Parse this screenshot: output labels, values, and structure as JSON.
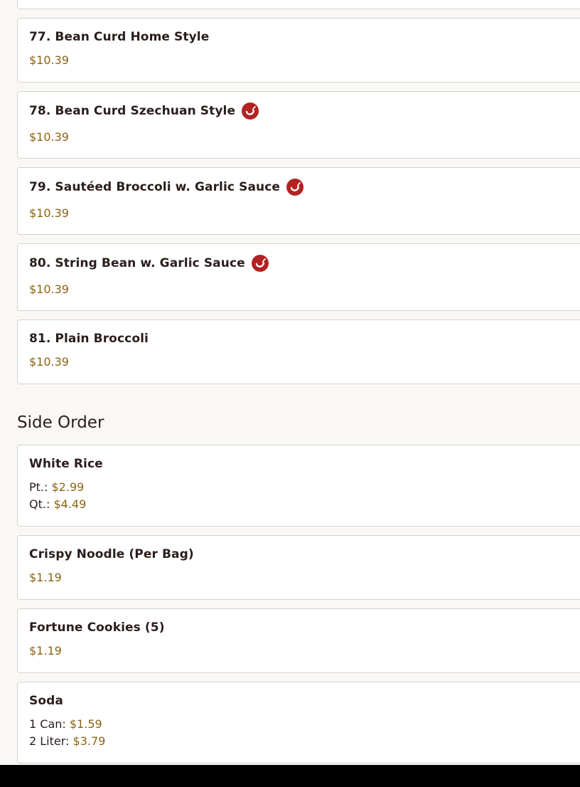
{
  "vegetable_items": [
    {
      "title": "77. Bean Curd Home Style",
      "price": "$10.39",
      "spicy": false
    },
    {
      "title": "78. Bean Curd Szechuan Style",
      "price": "$10.39",
      "spicy": true
    },
    {
      "title": "79. Sautéed Broccoli w. Garlic Sauce",
      "price": "$10.39",
      "spicy": true
    },
    {
      "title": "80. String Bean w. Garlic Sauce",
      "price": "$10.39",
      "spicy": true
    },
    {
      "title": "81. Plain Broccoli",
      "price": "$10.39",
      "spicy": false
    }
  ],
  "side_order": {
    "title": "Side Order",
    "items": [
      {
        "title": "White Rice",
        "prices": [
          {
            "label": "Pt.:",
            "value": "$2.99"
          },
          {
            "label": "Qt.:",
            "value": "$4.49"
          }
        ]
      },
      {
        "title": "Crispy Noodle (Per Bag)",
        "price": "$1.19"
      },
      {
        "title": "Fortune Cookies (5)",
        "price": "$1.19"
      },
      {
        "title": "Soda",
        "prices": [
          {
            "label": "1 Can:",
            "value": "$1.59"
          },
          {
            "label": "2 Liter:",
            "value": "$3.79"
          }
        ]
      }
    ]
  },
  "icons": {
    "spicy": "chili-pepper-icon"
  },
  "colors": {
    "price": "#8a6414",
    "spicy_badge": "#b22222",
    "card_border": "#d6d2cc"
  }
}
